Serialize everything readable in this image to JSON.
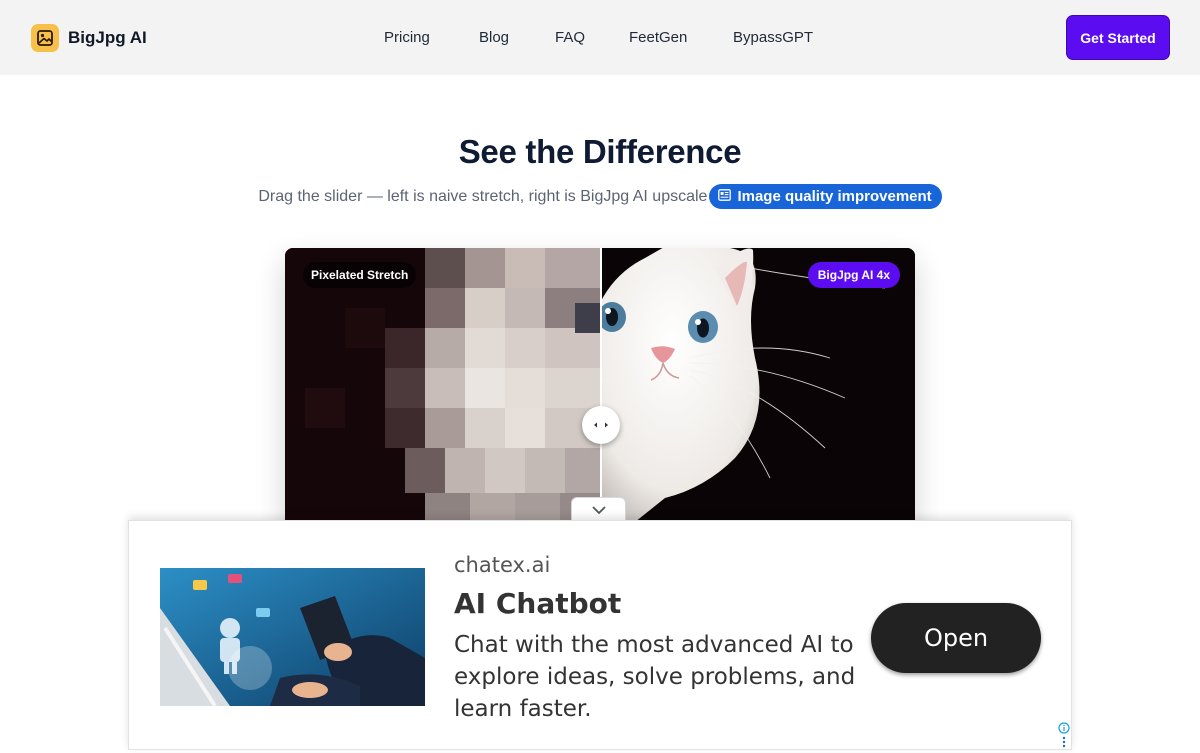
{
  "header": {
    "logo_text": "BigJpg AI",
    "logo_icon": "image-icon",
    "nav": [
      "Pricing",
      "Blog",
      "FAQ",
      "FeetGen",
      "BypassGPT"
    ],
    "cta_label": "Get Started"
  },
  "hero": {
    "title": "See the Difference",
    "subtitle": "Drag the slider — left is naive stretch, right is BigJpg AI upscale",
    "chip_label": "Image quality improvement",
    "chip_icon": "article-icon"
  },
  "compare": {
    "left_label": "Pixelated Stretch",
    "right_label": "BigJpg AI 4x",
    "slider_position": 0.5
  },
  "ad": {
    "domain": "chatex.ai",
    "title": "AI Chatbot",
    "description": "Chat with the most advanced AI to explore ideas, solve problems, and learn faster.",
    "button_label": "Open",
    "info_icon": "info-icon"
  },
  "colors": {
    "accent": "#5b0cf0",
    "chip": "#1765d8",
    "logo": "#f7c04a"
  }
}
